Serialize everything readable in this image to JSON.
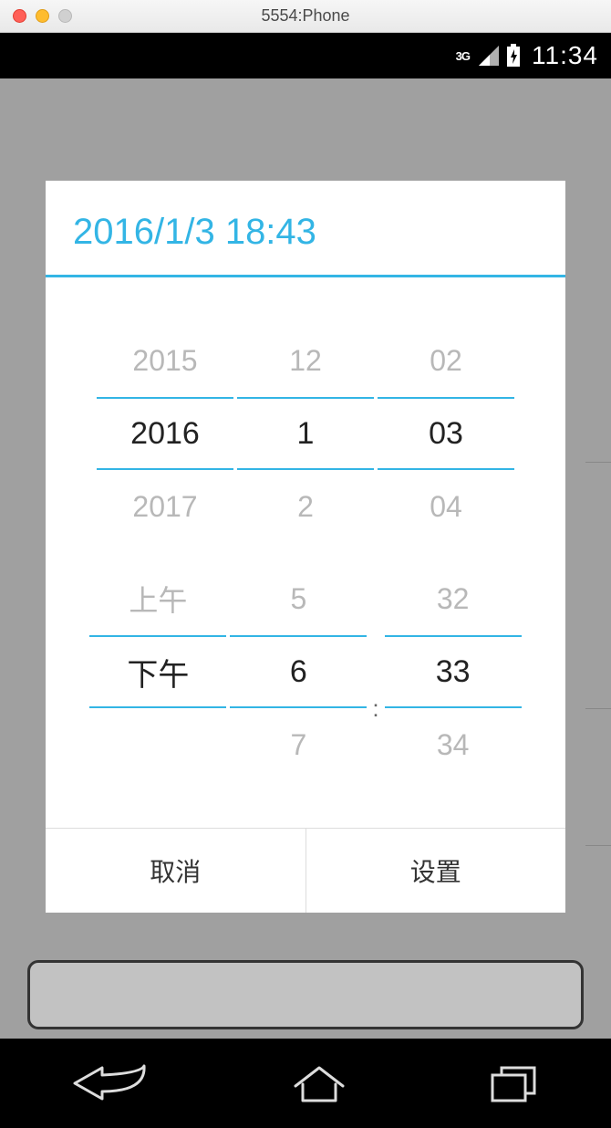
{
  "window": {
    "title": "5554:Phone"
  },
  "status_bar": {
    "network_label": "3G",
    "time": "11:34"
  },
  "dialog": {
    "title": "2016/1/3 18:43",
    "date": {
      "year": {
        "prev": "2015",
        "current": "2016",
        "next": "2017"
      },
      "month": {
        "prev": "12",
        "current": "1",
        "next": "2"
      },
      "day": {
        "prev": "02",
        "current": "03",
        "next": "04"
      }
    },
    "time": {
      "ampm": {
        "prev": "上午",
        "current": "下午",
        "next": ""
      },
      "hour": {
        "prev": "5",
        "current": "6",
        "next": "7"
      },
      "colon": ":",
      "minute": {
        "prev": "32",
        "current": "33",
        "next": "34"
      }
    },
    "buttons": {
      "cancel": "取消",
      "set": "设置"
    }
  }
}
